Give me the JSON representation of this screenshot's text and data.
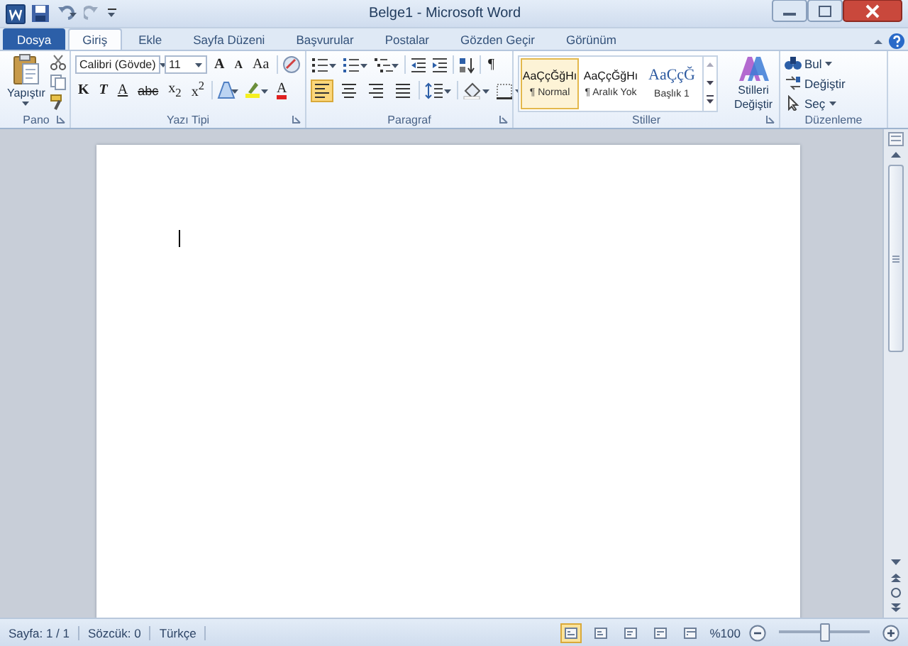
{
  "window": {
    "title": "Belge1 - Microsoft Word"
  },
  "tabs": [
    {
      "label": "Dosya",
      "kind": "file",
      "selected": false
    },
    {
      "label": "Giriş",
      "kind": "tab",
      "selected": true
    },
    {
      "label": "Ekle",
      "kind": "tab",
      "selected": false
    },
    {
      "label": "Sayfa Düzeni",
      "kind": "tab",
      "selected": false
    },
    {
      "label": "Başvurular",
      "kind": "tab",
      "selected": false
    },
    {
      "label": "Postalar",
      "kind": "tab",
      "selected": false
    },
    {
      "label": "Gözden Geçir",
      "kind": "tab",
      "selected": false
    },
    {
      "label": "Görünüm",
      "kind": "tab",
      "selected": false
    }
  ],
  "ribbon": {
    "clipboard": {
      "label": "Pano",
      "paste": "Yapıştır"
    },
    "font": {
      "label": "Yazı Tipi",
      "name": "Calibri (Gövde)",
      "size": "11",
      "tools_top": [
        {
          "kind": "grow",
          "text": "A"
        },
        {
          "kind": "shrink",
          "text": "A"
        },
        {
          "kind": "case",
          "text": "Aa"
        }
      ],
      "tools_bottom": [
        {
          "kind": "bold",
          "text": "K"
        },
        {
          "kind": "italic",
          "text": "T"
        },
        {
          "kind": "underline",
          "text": "A"
        },
        {
          "kind": "strike",
          "text": "abc"
        },
        {
          "kind": "sub",
          "text": "x$_{2}$"
        },
        {
          "kind": "sup",
          "text": "x$^{2}$"
        },
        {
          "kind": "color",
          "text": "A"
        }
      ]
    },
    "paragraph": {
      "label": "Paragraf",
      "pilcrow": "¶",
      "alignment": [
        {
          "selected": true
        },
        {
          "selected": false
        },
        {
          "selected": false
        },
        {
          "selected": false
        }
      ]
    },
    "styles": {
      "label": "Stiller",
      "items": [
        {
          "preview": "AaÇçĞğHı",
          "label": "¶ Normal",
          "kind": "body",
          "selected": true
        },
        {
          "preview": "AaÇçĞğHı",
          "label": "¶ Aralık Yok",
          "kind": "body",
          "selected": false
        },
        {
          "preview": "AaÇçĞ",
          "label": "Başlık 1",
          "kind": "heading",
          "selected": false
        }
      ],
      "change": "Stilleri Değiştir"
    },
    "editing": {
      "label": "Düzenleme",
      "items": [
        {
          "label": "Bul",
          "kind": "find",
          "dropdown": true
        },
        {
          "label": "Değiştir",
          "kind": "replace",
          "dropdown": false
        },
        {
          "label": "Seç",
          "kind": "select",
          "dropdown": true
        }
      ]
    }
  },
  "status_bar": {
    "page": "Sayfa: 1 / 1",
    "words": "Sözcük: 0",
    "language": "Türkçe",
    "views": [
      {
        "selected": true
      },
      {
        "selected": false
      },
      {
        "selected": false
      },
      {
        "selected": false
      },
      {
        "selected": false
      }
    ],
    "zoom": "%100",
    "zoom_slider": {
      "level": 0.5
    }
  }
}
